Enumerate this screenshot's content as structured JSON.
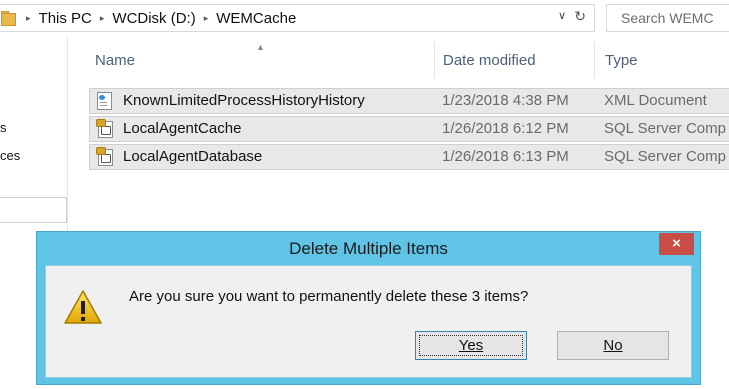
{
  "address_bar": {
    "crumbs": [
      "This PC",
      "WCDisk (D:)",
      "WEMCache"
    ],
    "separator": "▸",
    "dropdown_icon": "chevron-down-icon",
    "refresh_icon": "refresh-icon"
  },
  "search": {
    "placeholder": "Search WEMC"
  },
  "nav_pane": {
    "items": [
      "s",
      "ces"
    ]
  },
  "file_list": {
    "columns": [
      "Name",
      "Date modified",
      "Type"
    ],
    "rows": [
      {
        "name": "KnownLimitedProcessHistoryHistory",
        "date": "1/23/2018 4:38 PM",
        "type": "XML Document",
        "icon": "xml-file-icon"
      },
      {
        "name": "LocalAgentCache",
        "date": "1/26/2018 6:12 PM",
        "type": "SQL Server Comp",
        "icon": "sql-compact-file-icon"
      },
      {
        "name": "LocalAgentDatabase",
        "date": "1/26/2018 6:13 PM",
        "type": "SQL Server Comp",
        "icon": "sql-compact-file-icon"
      }
    ]
  },
  "dialog": {
    "title": "Delete Multiple Items",
    "close_label": "×",
    "message": "Are you sure you want to permanently delete these 3 items?",
    "yes_label": "Yes",
    "no_label": "No",
    "icon": "warning-icon"
  },
  "colors": {
    "dialog_frame": "#5fc4e6",
    "close_button": "#c94c45",
    "selected_row": "#e8e8e8"
  }
}
